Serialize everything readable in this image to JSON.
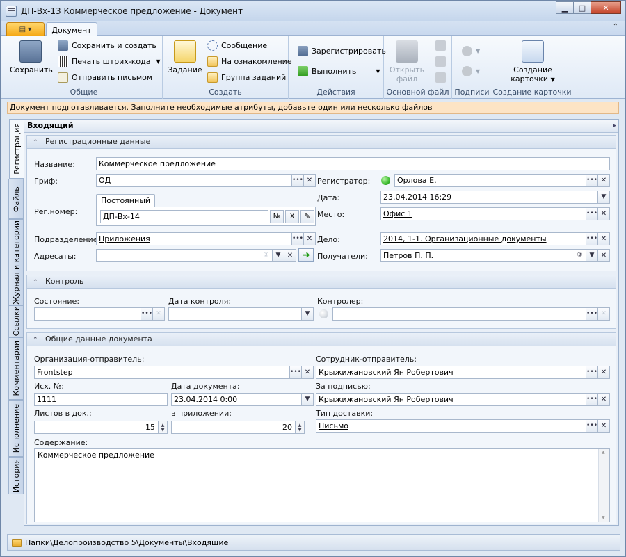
{
  "window": {
    "title": "ДП-Вх-13 Коммерческое предложение - Документ"
  },
  "ribbon": {
    "tab": "Документ",
    "groups": {
      "general": {
        "label": "Общие",
        "save": "Сохранить",
        "save_create": "Сохранить и создать",
        "print_barcode": "Печать штрих-кода",
        "send_mail": "Отправить письмом"
      },
      "create": {
        "label": "Создать",
        "task": "Задание",
        "message": "Сообщение",
        "review": "На ознакомление",
        "task_group": "Группа заданий"
      },
      "actions": {
        "label": "Действия",
        "register": "Зарегистрировать",
        "execute": "Выполнить"
      },
      "main_file": {
        "label": "Основной файл",
        "open_file_1": "Открыть",
        "open_file_2": "файл"
      },
      "signatures": {
        "label": "Подписи"
      },
      "card_create": {
        "label": "Создание карточки",
        "create_card_1": "Создание",
        "create_card_2": "карточки"
      }
    }
  },
  "infobar": "Документ подготавливается. Заполните необходимые атрибуты, добавьте один или несколько файлов",
  "side_tabs": [
    "Регистрация",
    "Файлы",
    "Журнал и категории",
    "Ссылки",
    "Комментарии",
    "Исполнение",
    "История"
  ],
  "content_title": "Входящий",
  "registration": {
    "header": "Регистрационные данные",
    "name_label": "Название:",
    "name_value": "Коммерческое предложение",
    "grif_label": "Гриф:",
    "grif_value": "ОД",
    "reg_number_label": "Рег.номер:",
    "reg_tab": "Постоянный",
    "reg_number_value": "ДП-Вх-14",
    "no_btn": "№",
    "x_btn": "X",
    "registrar_label": "Регистратор:",
    "registrar_value": "Орлова Е.",
    "date_label": "Дата:",
    "date_value": "23.04.2014 16:29",
    "place_label": "Место:",
    "place_value": "Офис 1",
    "division_label": "Подразделение:",
    "division_value": "Приложения",
    "case_label": "Дело:",
    "case_value": "2014, 1-1. Организационные документы",
    "addressees_label": "Адресаты:",
    "recipients_label": "Получатели:",
    "recipients_value": "Петров П. П."
  },
  "control": {
    "header": "Контроль",
    "state_label": "Состояние:",
    "control_date_label": "Дата контроля:",
    "controller_label": "Контролер:"
  },
  "common": {
    "header": "Общие данные документа",
    "sender_org_label": "Организация-отправитель:",
    "sender_org_value": "Frontstep",
    "sender_employee_label": "Сотрудник-отправитель:",
    "sender_employee_value": "Крыжижановский Ян Робертович",
    "out_no_label": "Исх. №:",
    "out_no_value": "1111",
    "doc_date_label": "Дата документа:",
    "doc_date_value": "23.04.2014 0:00",
    "signed_by_label": "За подписью:",
    "signed_by_value": "Крыжижановский Ян Робертович",
    "sheets_label": "Листов в док.:",
    "sheets_value": "15",
    "attach_label": "в приложении:",
    "attach_value": "20",
    "delivery_label": "Тип доставки:",
    "delivery_value": "Письмо",
    "content_label": "Содержание:",
    "content_value": "Коммерческое предложение"
  },
  "status": {
    "path": "Папки\\Делопроизводство 5\\Документы\\Входящие"
  },
  "colors": {
    "accent": "#f5a815",
    "info_bg": "#fde4c5",
    "led_green": "#3dbb2f"
  }
}
